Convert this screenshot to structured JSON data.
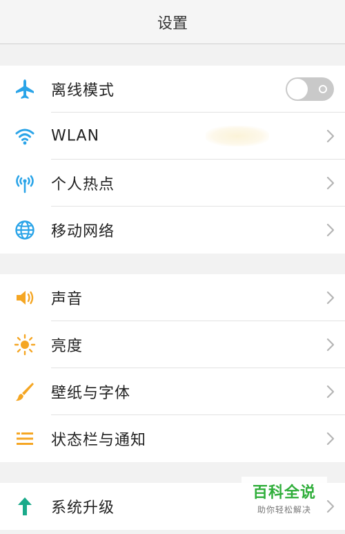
{
  "header": {
    "title": "设置"
  },
  "groups": [
    {
      "items": [
        {
          "label": "离线模式",
          "icon": "airplane-icon",
          "control": "toggle",
          "toggle_on": false
        },
        {
          "label": "WLAN",
          "icon": "wifi-icon",
          "control": "chevron"
        },
        {
          "label": "个人热点",
          "icon": "hotspot-icon",
          "control": "chevron"
        },
        {
          "label": "移动网络",
          "icon": "globe-icon",
          "control": "chevron"
        }
      ]
    },
    {
      "items": [
        {
          "label": "声音",
          "icon": "speaker-icon",
          "control": "chevron"
        },
        {
          "label": "亮度",
          "icon": "brightness-icon",
          "control": "chevron"
        },
        {
          "label": "壁纸与字体",
          "icon": "brush-icon",
          "control": "chevron"
        },
        {
          "label": "状态栏与通知",
          "icon": "statusbar-icon",
          "control": "chevron"
        }
      ]
    },
    {
      "items": [
        {
          "label": "系统升级",
          "icon": "upgrade-arrow-icon",
          "control": "chevron"
        }
      ]
    }
  ],
  "watermark": {
    "title": "百科全说",
    "subtitle": "助你轻松解决"
  },
  "colors": {
    "blue_icon": "#2aa4e8",
    "orange_icon": "#f5a623",
    "green_icon": "#1aaa8a",
    "toggle_off": "#c9c9c9",
    "watermark_green": "#2fae3a"
  }
}
